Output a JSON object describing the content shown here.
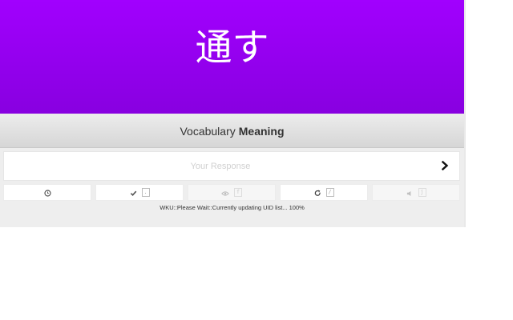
{
  "character": {
    "text": "通す",
    "background_color": "#a100fe"
  },
  "question": {
    "kind": "Vocabulary",
    "target": "Meaning"
  },
  "answer": {
    "placeholder": "Your Response",
    "value": "",
    "submit_icon": "chevron-right-icon"
  },
  "toolbar": {
    "buttons": [
      {
        "icon": "clock-icon",
        "hotkey": ""
      },
      {
        "icon": "check-icon",
        "hotkey": "."
      },
      {
        "icon": "eye-icon",
        "hotkey": "f"
      },
      {
        "icon": "redo-icon",
        "hotkey": "/"
      },
      {
        "icon": "audio-icon",
        "hotkey": "j"
      }
    ]
  },
  "status": {
    "text": "WKU::Please Wait::Currently updating UID list... 100%"
  }
}
